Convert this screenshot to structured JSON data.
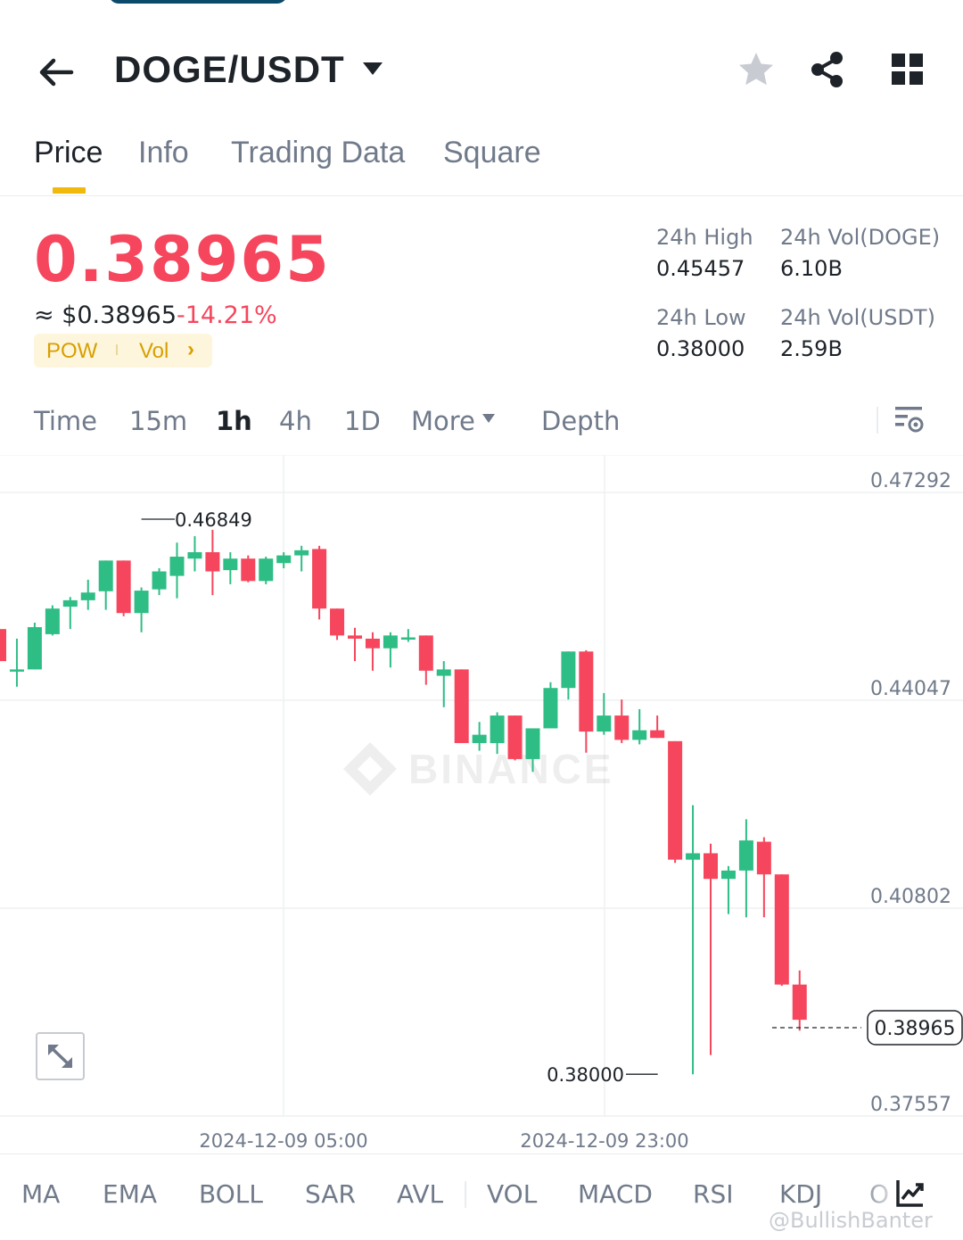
{
  "header": {
    "pair": "DOGE/USDT",
    "icons": [
      "back-arrow-icon",
      "caret-down-icon",
      "star-icon",
      "share-icon",
      "grid-icon"
    ]
  },
  "tabs": [
    {
      "label": "Price",
      "active": true
    },
    {
      "label": "Info",
      "active": false
    },
    {
      "label": "Trading Data",
      "active": false
    },
    {
      "label": "Square",
      "active": false
    }
  ],
  "price": {
    "last": "0.38965",
    "usd": "≈ $0.38965",
    "change": "-14.21%",
    "tags": {
      "pow": "POW",
      "vol": "Vol",
      "chevron": "›"
    }
  },
  "stats": {
    "high_label": "24h High",
    "high_value": "0.45457",
    "low_label": "24h Low",
    "low_value": "0.38000",
    "vol_base_label": "24h Vol(DOGE)",
    "vol_base_value": "6.10B",
    "vol_quote_label": "24h Vol(USDT)",
    "vol_quote_value": "2.59B"
  },
  "intervals": [
    {
      "label": "Time",
      "active": false
    },
    {
      "label": "15m",
      "active": false
    },
    {
      "label": "1h",
      "active": true
    },
    {
      "label": "4h",
      "active": false
    },
    {
      "label": "1D",
      "active": false
    },
    {
      "label": "More",
      "active": false
    },
    {
      "label": "Depth",
      "active": false
    }
  ],
  "chart_data": {
    "type": "candlestick",
    "interval": "1h",
    "y_ticks": [
      "0.47292",
      "0.44047",
      "0.40802",
      "0.37557"
    ],
    "ylim": [
      0.37557,
      0.47292
    ],
    "x_ticks": [
      "2024-12-09 05:00",
      "2024-12-09 23:00"
    ],
    "max_label": "0.46849",
    "min_label": "0.38000",
    "last_price_label": "0.38965",
    "watermark": "BINANCE",
    "colors": {
      "up": "#2ebd85",
      "down": "#f6465d",
      "grid": "#eef0f2",
      "text": "#707a8a"
    },
    "candles": [
      {
        "o": 0.4495,
        "h": 0.4575,
        "l": 0.4445,
        "c": 0.4445
      },
      {
        "o": 0.4432,
        "h": 0.448,
        "l": 0.4405,
        "c": 0.4432
      },
      {
        "o": 0.4432,
        "h": 0.4505,
        "l": 0.4432,
        "c": 0.4498
      },
      {
        "o": 0.4487,
        "h": 0.4532,
        "l": 0.4485,
        "c": 0.4527
      },
      {
        "o": 0.453,
        "h": 0.4545,
        "l": 0.4495,
        "c": 0.454
      },
      {
        "o": 0.454,
        "h": 0.4572,
        "l": 0.4525,
        "c": 0.4552
      },
      {
        "o": 0.4554,
        "h": 0.4602,
        "l": 0.4525,
        "c": 0.4602
      },
      {
        "o": 0.4602,
        "h": 0.4602,
        "l": 0.4515,
        "c": 0.452
      },
      {
        "o": 0.452,
        "h": 0.456,
        "l": 0.449,
        "c": 0.4555
      },
      {
        "o": 0.4557,
        "h": 0.459,
        "l": 0.4548,
        "c": 0.4585
      },
      {
        "o": 0.4578,
        "h": 0.463,
        "l": 0.4543,
        "c": 0.4608
      },
      {
        "o": 0.4605,
        "h": 0.464,
        "l": 0.4585,
        "c": 0.4615
      },
      {
        "o": 0.4615,
        "h": 0.465,
        "l": 0.4548,
        "c": 0.4585
      },
      {
        "o": 0.4587,
        "h": 0.4615,
        "l": 0.4565,
        "c": 0.4605
      },
      {
        "o": 0.4605,
        "h": 0.461,
        "l": 0.4568,
        "c": 0.457
      },
      {
        "o": 0.457,
        "h": 0.4608,
        "l": 0.4565,
        "c": 0.4605
      },
      {
        "o": 0.4598,
        "h": 0.4615,
        "l": 0.459,
        "c": 0.461
      },
      {
        "o": 0.461,
        "h": 0.4625,
        "l": 0.4585,
        "c": 0.4618
      },
      {
        "o": 0.462,
        "h": 0.4625,
        "l": 0.451,
        "c": 0.4527
      },
      {
        "o": 0.4527,
        "h": 0.4527,
        "l": 0.4478,
        "c": 0.4485
      },
      {
        "o": 0.4485,
        "h": 0.4497,
        "l": 0.4445,
        "c": 0.448
      },
      {
        "o": 0.448,
        "h": 0.449,
        "l": 0.443,
        "c": 0.4465
      },
      {
        "o": 0.4465,
        "h": 0.449,
        "l": 0.4435,
        "c": 0.4485
      },
      {
        "o": 0.448,
        "h": 0.4495,
        "l": 0.4475,
        "c": 0.4482
      },
      {
        "o": 0.4485,
        "h": 0.4485,
        "l": 0.4408,
        "c": 0.443
      },
      {
        "o": 0.4422,
        "h": 0.4445,
        "l": 0.4373,
        "c": 0.4432
      },
      {
        "o": 0.4432,
        "h": 0.4432,
        "l": 0.4317,
        "c": 0.4317
      },
      {
        "o": 0.4317,
        "h": 0.435,
        "l": 0.4305,
        "c": 0.433
      },
      {
        "o": 0.4317,
        "h": 0.4365,
        "l": 0.43,
        "c": 0.436
      },
      {
        "o": 0.436,
        "h": 0.436,
        "l": 0.429,
        "c": 0.4292
      },
      {
        "o": 0.4292,
        "h": 0.4335,
        "l": 0.4272,
        "c": 0.434
      },
      {
        "o": 0.434,
        "h": 0.4412,
        "l": 0.434,
        "c": 0.4403
      },
      {
        "o": 0.4403,
        "h": 0.446,
        "l": 0.4385,
        "c": 0.446
      },
      {
        "o": 0.446,
        "h": 0.4462,
        "l": 0.4302,
        "c": 0.4335
      },
      {
        "o": 0.4335,
        "h": 0.4395,
        "l": 0.433,
        "c": 0.436
      },
      {
        "o": 0.436,
        "h": 0.4385,
        "l": 0.4317,
        "c": 0.4322
      },
      {
        "o": 0.4322,
        "h": 0.437,
        "l": 0.4315,
        "c": 0.4337
      },
      {
        "o": 0.4337,
        "h": 0.436,
        "l": 0.4325,
        "c": 0.4325
      },
      {
        "o": 0.432,
        "h": 0.432,
        "l": 0.413,
        "c": 0.4135
      },
      {
        "o": 0.4135,
        "h": 0.422,
        "l": 0.38,
        "c": 0.4145
      },
      {
        "o": 0.4145,
        "h": 0.416,
        "l": 0.383,
        "c": 0.4105
      },
      {
        "o": 0.4105,
        "h": 0.4125,
        "l": 0.405,
        "c": 0.4118
      },
      {
        "o": 0.4118,
        "h": 0.4198,
        "l": 0.4045,
        "c": 0.4165
      },
      {
        "o": 0.4163,
        "h": 0.417,
        "l": 0.4045,
        "c": 0.4112
      },
      {
        "o": 0.4112,
        "h": 0.4112,
        "l": 0.3938,
        "c": 0.394
      },
      {
        "o": 0.394,
        "h": 0.3962,
        "l": 0.3868,
        "c": 0.3885
      }
    ]
  },
  "indicators": [
    "MA",
    "EMA",
    "BOLL",
    "SAR",
    "AVL",
    "VOL",
    "MACD",
    "RSI",
    "KDJ",
    "O"
  ],
  "footer": {
    "watermark_user": "@BullishBanter"
  }
}
